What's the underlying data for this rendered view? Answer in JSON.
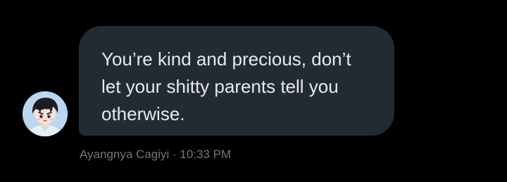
{
  "message": {
    "text": "You’re kind and precious, don’t let your shitty parents tell you otherwise.",
    "sender": "Ayangnya Cagiyi",
    "separator": "·",
    "time": "10:33 PM"
  },
  "colors": {
    "background": "#000000",
    "bubble": "#232b32",
    "text": "#e7e9ea",
    "meta": "#71767b"
  },
  "icons": {
    "avatar": "anime-boy-avatar"
  }
}
